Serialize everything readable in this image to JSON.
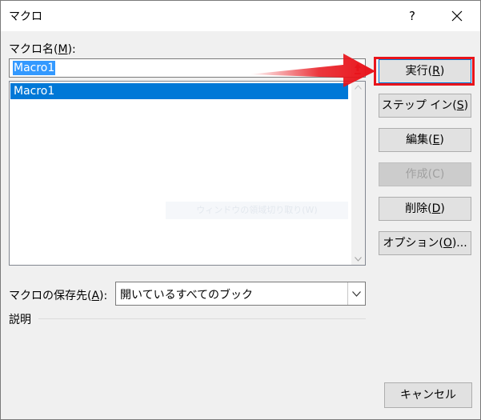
{
  "window": {
    "title": "マクロ",
    "help_label": "?"
  },
  "macro_name": {
    "label_prefix": "マクロ名(",
    "label_key": "M",
    "label_suffix": "):",
    "value": "Macro1"
  },
  "macro_list": {
    "items": [
      "Macro1"
    ],
    "selected": "Macro1"
  },
  "watermark_text": "ウィンドウの領域切り取り(W)",
  "buttons": [
    {
      "prefix": "実行(",
      "key": "R",
      "suffix": ")",
      "enabled": true
    },
    {
      "prefix": "ステップ イン(",
      "key": "S",
      "suffix": ")",
      "enabled": true
    },
    {
      "prefix": "編集(",
      "key": "E",
      "suffix": ")",
      "enabled": true
    },
    {
      "prefix": "作成(C)",
      "key": "",
      "suffix": "",
      "enabled": false
    },
    {
      "prefix": "削除(",
      "key": "D",
      "suffix": ")",
      "enabled": true
    },
    {
      "prefix": "オプション(",
      "key": "O",
      "suffix": ")...",
      "enabled": true
    }
  ],
  "location": {
    "label_prefix": "マクロの保存先(",
    "label_key": "A",
    "label_suffix": "):",
    "value": "開いているすべてのブック"
  },
  "description_label": "説明",
  "cancel_label": "キャンセル",
  "colors": {
    "highlight": "#e8141b",
    "selection": "#0078d7"
  }
}
